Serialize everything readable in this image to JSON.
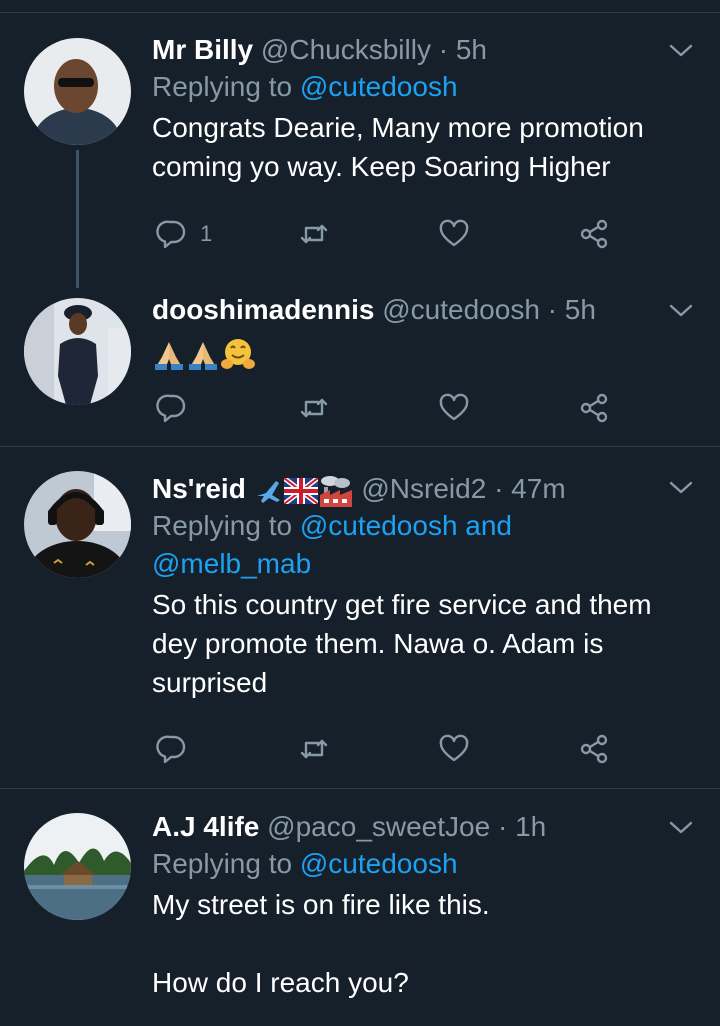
{
  "tweets": [
    {
      "name": "Mr Billy",
      "handle": "@Chucksbilly",
      "dot": "·",
      "time": "5h",
      "replying_prefix": "Replying to ",
      "replying_to": "@cutedoosh",
      "text_lines": [
        "Congrats Dearie, Many more promotion",
        "coming yo way. Keep Soaring Higher"
      ],
      "reply_count": "1"
    },
    {
      "name": "dooshimadennis",
      "handle": "@cutedoosh",
      "dot": "·",
      "time": "5h",
      "emojis": [
        "folded-hands-emoji",
        "folded-hands-emoji",
        "hugging-face-emoji"
      ]
    },
    {
      "name": "Ns'reid",
      "name_emojis": [
        "airplane-emoji",
        "uk-flag-emoji",
        "factory-emoji"
      ],
      "handle": "@Nsreid2",
      "dot": "·",
      "time": "47m",
      "replying_prefix": "Replying to ",
      "replying_to_line1": "@cutedoosh and",
      "replying_to_line2": "@melb_mab",
      "text_lines": [
        "So this country get fire service and them",
        "dey promote them. Nawa o. Adam is",
        "surprised"
      ]
    },
    {
      "name": "A.J 4life",
      "handle": "@paco_sweetJoe",
      "dot": "·",
      "time": "1h",
      "replying_prefix": "Replying to ",
      "replying_to": "@cutedoosh",
      "text_lines": [
        "My street is on fire like this.",
        "",
        "How do I reach you?"
      ]
    }
  ],
  "colors": {
    "background": "#15202b",
    "secondary_text": "#8899a6",
    "mention": "#1da1f2",
    "separator": "#2f3d4a"
  },
  "icons": [
    "reply-icon",
    "retweet-icon",
    "like-icon",
    "share-icon",
    "chevron-down-icon"
  ]
}
